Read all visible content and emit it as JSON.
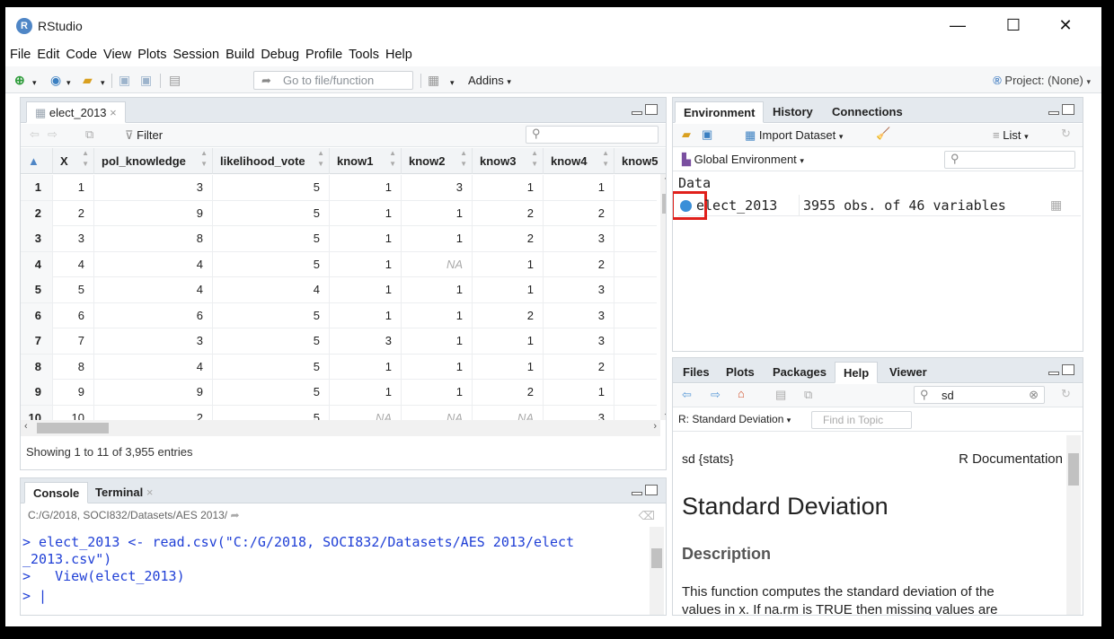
{
  "window": {
    "title": "RStudio",
    "logo": "R",
    "minimize": "—",
    "maximize": "☐",
    "close": "✕"
  },
  "menu": [
    "File",
    "Edit",
    "Code",
    "View",
    "Plots",
    "Session",
    "Build",
    "Debug",
    "Profile",
    "Tools",
    "Help"
  ],
  "toolbar": {
    "goto_placeholder": "Go to file/function",
    "addins_label": "Addins",
    "project_label": "Project: (None)"
  },
  "viewer": {
    "tab_label": "elect_2013",
    "filter_label": "Filter",
    "columns": [
      "",
      "X",
      "pol_knowledge",
      "likelihood_vote",
      "know1",
      "know2",
      "know3",
      "know4",
      "know5"
    ],
    "rows": [
      [
        "1",
        "1",
        "3",
        "5",
        "1",
        "3",
        "1",
        "1"
      ],
      [
        "2",
        "2",
        "9",
        "5",
        "1",
        "1",
        "2",
        "2"
      ],
      [
        "3",
        "3",
        "8",
        "5",
        "1",
        "1",
        "2",
        "3"
      ],
      [
        "4",
        "4",
        "4",
        "5",
        "1",
        "NA",
        "1",
        "2"
      ],
      [
        "5",
        "5",
        "4",
        "4",
        "1",
        "1",
        "1",
        "3"
      ],
      [
        "6",
        "6",
        "6",
        "5",
        "1",
        "1",
        "2",
        "3"
      ],
      [
        "7",
        "7",
        "3",
        "5",
        "3",
        "1",
        "1",
        "3"
      ],
      [
        "8",
        "8",
        "4",
        "5",
        "1",
        "1",
        "1",
        "2"
      ],
      [
        "9",
        "9",
        "9",
        "5",
        "1",
        "1",
        "2",
        "1"
      ],
      [
        "10",
        "10",
        "2",
        "5",
        "NA",
        "NA",
        "NA",
        "3"
      ]
    ],
    "status": "Showing 1 to 11 of 3,955 entries"
  },
  "console": {
    "tabs": [
      "Console",
      "Terminal"
    ],
    "path": "C:/G/2018, SOCI832/Datasets/AES 2013/",
    "lines": [
      "> elect_2013 <- read.csv(\"C:/G/2018, SOCI832/Datasets/AES 2013/elect",
      "_2013.csv\")",
      ">   View(elect_2013)",
      "> |"
    ]
  },
  "environment": {
    "tabs": [
      "Environment",
      "History",
      "Connections"
    ],
    "import_label": "Import Dataset",
    "list_label": "List",
    "scope_label": "Global Environment",
    "section": "Data",
    "object_name": "elect_2013",
    "object_desc": "3955 obs. of 46 variables"
  },
  "files": {
    "tabs": [
      "Files",
      "Plots",
      "Packages",
      "Help",
      "Viewer"
    ],
    "search_value": "sd",
    "topic_label": "R: Standard Deviation",
    "find_placeholder": "Find in Topic",
    "doc_name": "sd {stats}",
    "doc_source": "R Documentation",
    "doc_title": "Standard Deviation",
    "section_title": "Description",
    "body_line1": "This function computes the standard deviation of the",
    "body_line2": "values in x. If na.rm is TRUE then missing values are"
  },
  "colors": {
    "highlight": "#e0201b",
    "console_text": "#1f3fd6",
    "accent": "#4f86c6"
  }
}
